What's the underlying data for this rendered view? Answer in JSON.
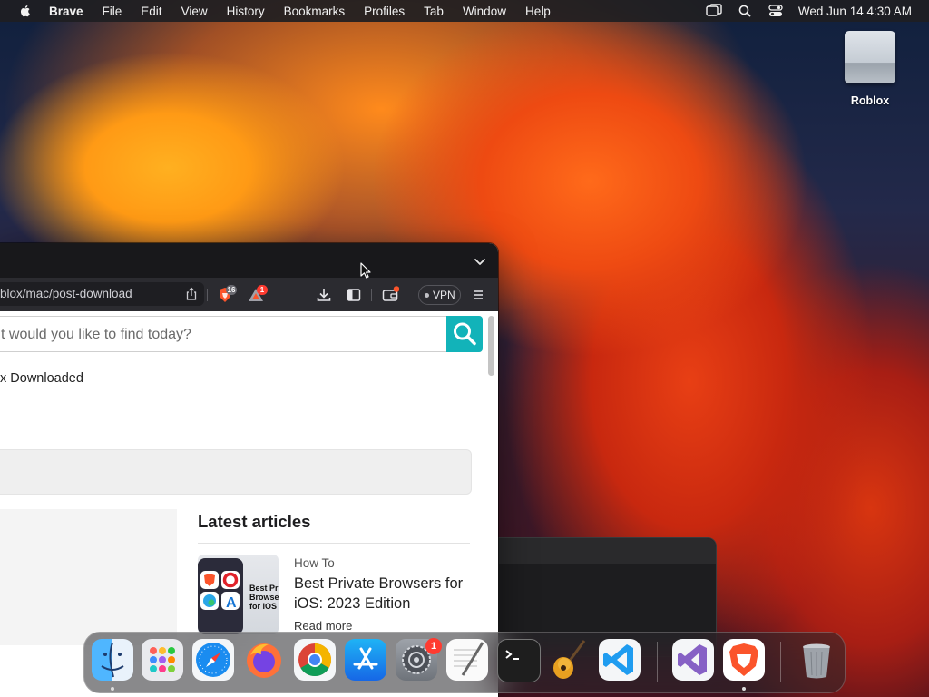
{
  "menubar": {
    "app_name": "Brave",
    "items": [
      "File",
      "Edit",
      "View",
      "History",
      "Bookmarks",
      "Profiles",
      "Tab",
      "Window",
      "Help"
    ],
    "clock": "Wed Jun 14  4:30 AM",
    "status_icons": [
      "screen-mirroring-icon",
      "spotlight-search-icon",
      "control-center-icon"
    ]
  },
  "desktop": {
    "drive_label": "Roblox"
  },
  "browser": {
    "url": "blox/mac/post-download",
    "shields_count": "16",
    "rewards_count": "1",
    "vpn_label": "VPN",
    "page": {
      "search_placeholder": "t would you like to find today?",
      "downloaded_text": "x Downloaded",
      "latest_title": "Latest articles",
      "article": {
        "category": "How To",
        "title": "Best Private Browsers for iOS: 2023 Edition",
        "read_more": "Read more",
        "thumb_text": [
          "Best Pr",
          "Browse",
          "for iOS"
        ]
      }
    }
  },
  "dock": {
    "apps": [
      "Finder",
      "Launchpad",
      "Safari",
      "Firefox",
      "Chrome",
      "App Store",
      "System Settings",
      "TextEdit",
      "Terminal",
      "GarageBand",
      "Visual Studio Code",
      "Visual Studio",
      "Brave Browser",
      "Trash"
    ],
    "settings_badge": "1"
  },
  "colors": {
    "search_button": "#12b3b9",
    "brave_orange": "#fb542b",
    "badge_red": "#ff3b30"
  }
}
